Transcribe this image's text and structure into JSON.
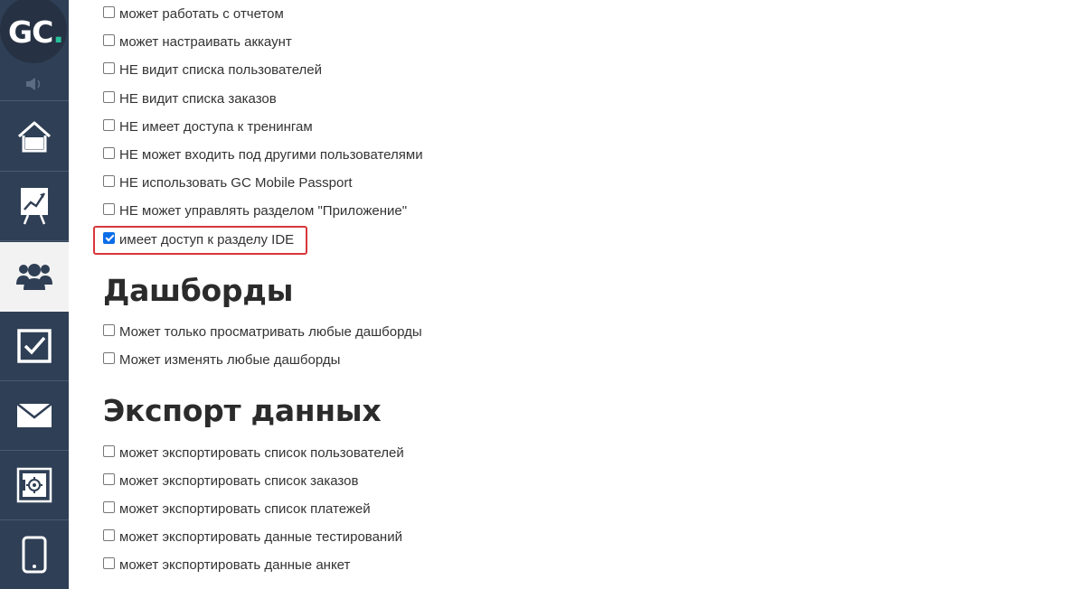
{
  "logo": {
    "text_main": "GC",
    "text_dot": "."
  },
  "nav": {
    "items": [
      {
        "icon": "speaker-icon"
      },
      {
        "icon": "home-icon"
      },
      {
        "icon": "chart-icon"
      },
      {
        "icon": "users-icon",
        "active": true
      },
      {
        "icon": "checkbox-icon"
      },
      {
        "icon": "mail-icon"
      },
      {
        "icon": "safe-icon"
      },
      {
        "icon": "mobile-icon"
      }
    ]
  },
  "permissions": [
    {
      "label": "может работать с отчетом",
      "checked": false
    },
    {
      "label": "может настраивать аккаунт",
      "checked": false
    },
    {
      "label": "НЕ видит списка пользователей",
      "checked": false
    },
    {
      "label": "НЕ видит списка заказов",
      "checked": false
    },
    {
      "label": "НЕ имеет доступа к тренингам",
      "checked": false
    },
    {
      "label": "НЕ может входить под другими пользователями",
      "checked": false
    },
    {
      "label": "НЕ использовать GC Mobile Passport",
      "checked": false
    },
    {
      "label": "НЕ может управлять разделом \"Приложение\"",
      "checked": false
    },
    {
      "label": "имеет доступ к разделу IDE",
      "checked": true
    }
  ],
  "dashboards": {
    "title": "Дашборды",
    "items": [
      {
        "label": "Может только просматривать любые дашборды",
        "checked": false
      },
      {
        "label": "Может изменять любые дашборды",
        "checked": false
      }
    ]
  },
  "export": {
    "title": "Экспорт данных",
    "items": [
      {
        "label": "может экспортировать список пользователей",
        "checked": false
      },
      {
        "label": "может экспортировать список заказов",
        "checked": false
      },
      {
        "label": "может экспортировать список платежей",
        "checked": false
      },
      {
        "label": "может экспортировать данные тестирований",
        "checked": false
      },
      {
        "label": "может экспортировать данные анкет",
        "checked": false
      }
    ]
  },
  "colors": {
    "sidebar": "#2f3f55",
    "accent": "#27c29a",
    "highlight": "#d8363b",
    "checkbox_checked": "#0b6ee8"
  }
}
